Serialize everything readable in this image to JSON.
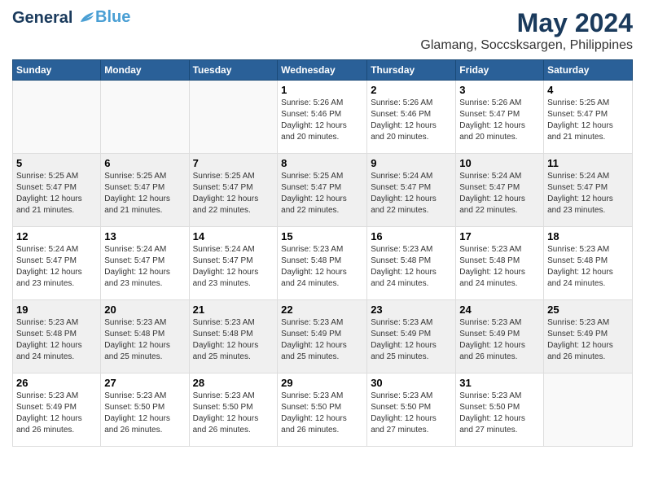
{
  "header": {
    "logo_line1": "General",
    "logo_line2": "Blue",
    "title": "May 2024",
    "subtitle": "Glamang, Soccsksargen, Philippines"
  },
  "days_of_week": [
    "Sunday",
    "Monday",
    "Tuesday",
    "Wednesday",
    "Thursday",
    "Friday",
    "Saturday"
  ],
  "weeks": [
    [
      {
        "day": "",
        "info": ""
      },
      {
        "day": "",
        "info": ""
      },
      {
        "day": "",
        "info": ""
      },
      {
        "day": "1",
        "info": "Sunrise: 5:26 AM\nSunset: 5:46 PM\nDaylight: 12 hours\nand 20 minutes."
      },
      {
        "day": "2",
        "info": "Sunrise: 5:26 AM\nSunset: 5:46 PM\nDaylight: 12 hours\nand 20 minutes."
      },
      {
        "day": "3",
        "info": "Sunrise: 5:26 AM\nSunset: 5:47 PM\nDaylight: 12 hours\nand 20 minutes."
      },
      {
        "day": "4",
        "info": "Sunrise: 5:25 AM\nSunset: 5:47 PM\nDaylight: 12 hours\nand 21 minutes."
      }
    ],
    [
      {
        "day": "5",
        "info": "Sunrise: 5:25 AM\nSunset: 5:47 PM\nDaylight: 12 hours\nand 21 minutes."
      },
      {
        "day": "6",
        "info": "Sunrise: 5:25 AM\nSunset: 5:47 PM\nDaylight: 12 hours\nand 21 minutes."
      },
      {
        "day": "7",
        "info": "Sunrise: 5:25 AM\nSunset: 5:47 PM\nDaylight: 12 hours\nand 22 minutes."
      },
      {
        "day": "8",
        "info": "Sunrise: 5:25 AM\nSunset: 5:47 PM\nDaylight: 12 hours\nand 22 minutes."
      },
      {
        "day": "9",
        "info": "Sunrise: 5:24 AM\nSunset: 5:47 PM\nDaylight: 12 hours\nand 22 minutes."
      },
      {
        "day": "10",
        "info": "Sunrise: 5:24 AM\nSunset: 5:47 PM\nDaylight: 12 hours\nand 22 minutes."
      },
      {
        "day": "11",
        "info": "Sunrise: 5:24 AM\nSunset: 5:47 PM\nDaylight: 12 hours\nand 23 minutes."
      }
    ],
    [
      {
        "day": "12",
        "info": "Sunrise: 5:24 AM\nSunset: 5:47 PM\nDaylight: 12 hours\nand 23 minutes."
      },
      {
        "day": "13",
        "info": "Sunrise: 5:24 AM\nSunset: 5:47 PM\nDaylight: 12 hours\nand 23 minutes."
      },
      {
        "day": "14",
        "info": "Sunrise: 5:24 AM\nSunset: 5:47 PM\nDaylight: 12 hours\nand 23 minutes."
      },
      {
        "day": "15",
        "info": "Sunrise: 5:23 AM\nSunset: 5:48 PM\nDaylight: 12 hours\nand 24 minutes."
      },
      {
        "day": "16",
        "info": "Sunrise: 5:23 AM\nSunset: 5:48 PM\nDaylight: 12 hours\nand 24 minutes."
      },
      {
        "day": "17",
        "info": "Sunrise: 5:23 AM\nSunset: 5:48 PM\nDaylight: 12 hours\nand 24 minutes."
      },
      {
        "day": "18",
        "info": "Sunrise: 5:23 AM\nSunset: 5:48 PM\nDaylight: 12 hours\nand 24 minutes."
      }
    ],
    [
      {
        "day": "19",
        "info": "Sunrise: 5:23 AM\nSunset: 5:48 PM\nDaylight: 12 hours\nand 24 minutes."
      },
      {
        "day": "20",
        "info": "Sunrise: 5:23 AM\nSunset: 5:48 PM\nDaylight: 12 hours\nand 25 minutes."
      },
      {
        "day": "21",
        "info": "Sunrise: 5:23 AM\nSunset: 5:48 PM\nDaylight: 12 hours\nand 25 minutes."
      },
      {
        "day": "22",
        "info": "Sunrise: 5:23 AM\nSunset: 5:49 PM\nDaylight: 12 hours\nand 25 minutes."
      },
      {
        "day": "23",
        "info": "Sunrise: 5:23 AM\nSunset: 5:49 PM\nDaylight: 12 hours\nand 25 minutes."
      },
      {
        "day": "24",
        "info": "Sunrise: 5:23 AM\nSunset: 5:49 PM\nDaylight: 12 hours\nand 26 minutes."
      },
      {
        "day": "25",
        "info": "Sunrise: 5:23 AM\nSunset: 5:49 PM\nDaylight: 12 hours\nand 26 minutes."
      }
    ],
    [
      {
        "day": "26",
        "info": "Sunrise: 5:23 AM\nSunset: 5:49 PM\nDaylight: 12 hours\nand 26 minutes."
      },
      {
        "day": "27",
        "info": "Sunrise: 5:23 AM\nSunset: 5:50 PM\nDaylight: 12 hours\nand 26 minutes."
      },
      {
        "day": "28",
        "info": "Sunrise: 5:23 AM\nSunset: 5:50 PM\nDaylight: 12 hours\nand 26 minutes."
      },
      {
        "day": "29",
        "info": "Sunrise: 5:23 AM\nSunset: 5:50 PM\nDaylight: 12 hours\nand 26 minutes."
      },
      {
        "day": "30",
        "info": "Sunrise: 5:23 AM\nSunset: 5:50 PM\nDaylight: 12 hours\nand 27 minutes."
      },
      {
        "day": "31",
        "info": "Sunrise: 5:23 AM\nSunset: 5:50 PM\nDaylight: 12 hours\nand 27 minutes."
      },
      {
        "day": "",
        "info": ""
      }
    ]
  ]
}
